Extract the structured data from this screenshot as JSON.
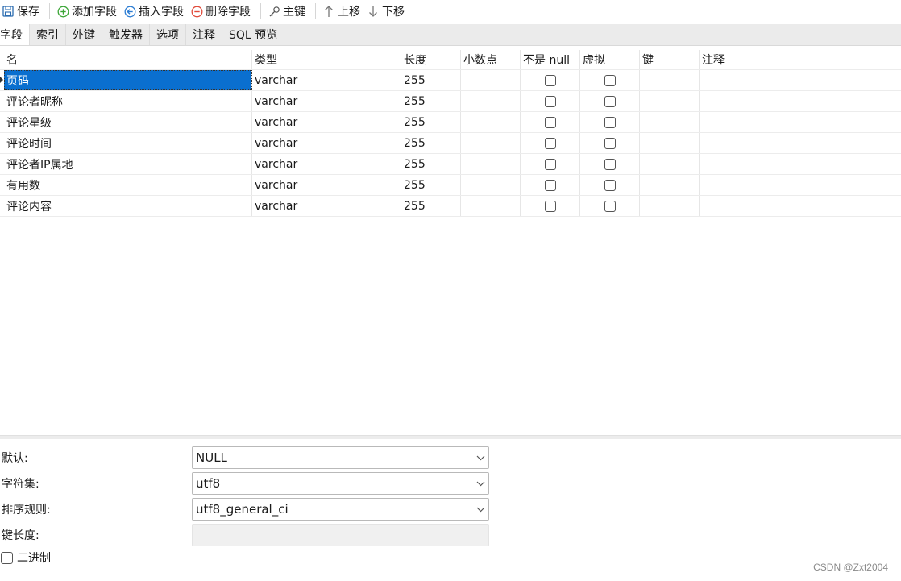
{
  "toolbar": {
    "save": "保存",
    "add_field": "添加字段",
    "insert_field": "插入字段",
    "delete_field": "删除字段",
    "primary_key": "主键",
    "move_up": "上移",
    "move_down": "下移"
  },
  "tabs": [
    {
      "label": "字段",
      "active": true
    },
    {
      "label": "索引"
    },
    {
      "label": "外键"
    },
    {
      "label": "触发器"
    },
    {
      "label": "选项"
    },
    {
      "label": "注释"
    },
    {
      "label": "SQL 预览"
    }
  ],
  "grid": {
    "columns": [
      "名",
      "类型",
      "长度",
      "小数点",
      "不是 null",
      "虚拟",
      "键",
      "注释"
    ],
    "rows": [
      {
        "name": "页码",
        "type": "varchar",
        "length": "255",
        "decimals": "",
        "not_null": false,
        "virtual": false,
        "key": "",
        "comment": ""
      },
      {
        "name": "评论者昵称",
        "type": "varchar",
        "length": "255",
        "decimals": "",
        "not_null": false,
        "virtual": false,
        "key": "",
        "comment": ""
      },
      {
        "name": "评论星级",
        "type": "varchar",
        "length": "255",
        "decimals": "",
        "not_null": false,
        "virtual": false,
        "key": "",
        "comment": ""
      },
      {
        "name": "评论时间",
        "type": "varchar",
        "length": "255",
        "decimals": "",
        "not_null": false,
        "virtual": false,
        "key": "",
        "comment": ""
      },
      {
        "name": "评论者IP属地",
        "type": "varchar",
        "length": "255",
        "decimals": "",
        "not_null": false,
        "virtual": false,
        "key": "",
        "comment": ""
      },
      {
        "name": "有用数",
        "type": "varchar",
        "length": "255",
        "decimals": "",
        "not_null": false,
        "virtual": false,
        "key": "",
        "comment": ""
      },
      {
        "name": "评论内容",
        "type": "varchar",
        "length": "255",
        "decimals": "",
        "not_null": false,
        "virtual": false,
        "key": "",
        "comment": ""
      }
    ]
  },
  "properties": {
    "default": {
      "label": "默认:",
      "value": "NULL"
    },
    "charset": {
      "label": "字符集:",
      "value": "utf8"
    },
    "collation": {
      "label": "排序规则:",
      "value": "utf8_general_ci"
    },
    "key_length": {
      "label": "键长度:",
      "value": ""
    },
    "binary": {
      "label": "二进制",
      "checked": false
    }
  },
  "watermark": "CSDN @Zxt2004",
  "colors": {
    "selection": "#0a6fcf",
    "tab_bar": "#ebebeb",
    "add_icon": "#3aa535",
    "insert_icon": "#2b7cd3",
    "delete_icon": "#e04a3a"
  }
}
